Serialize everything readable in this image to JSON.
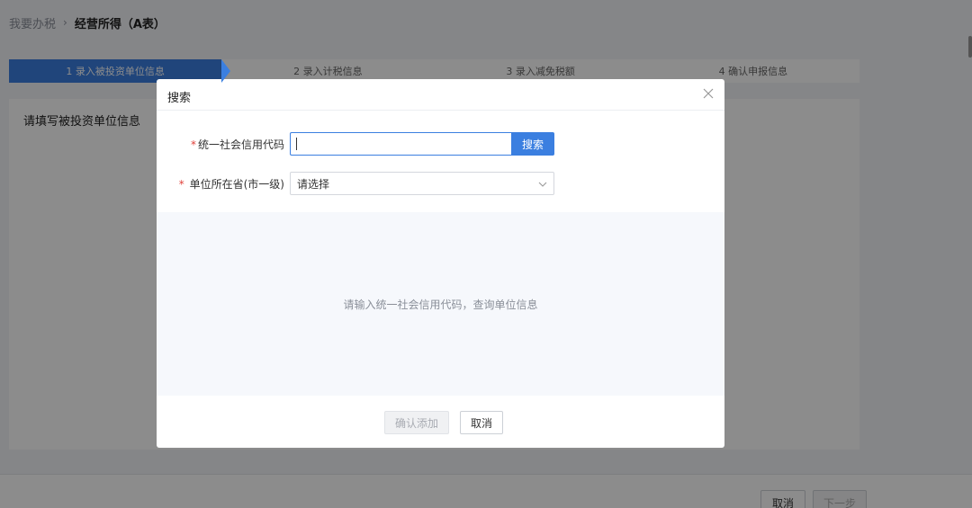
{
  "breadcrumb": {
    "parent": "我要办税",
    "separator": "›",
    "current": "经营所得（A表）"
  },
  "steps": [
    {
      "label": "1 录入被投资单位信息",
      "active": true
    },
    {
      "label": "2 录入计税信息",
      "active": false
    },
    {
      "label": "3 录入减免税额",
      "active": false
    },
    {
      "label": "4 确认申报信息",
      "active": false
    }
  ],
  "main": {
    "title": "请填写被投资单位信息"
  },
  "footer": {
    "cancel_label": "取消",
    "next_label": "下一步"
  },
  "dialog": {
    "title": "搜索",
    "fields": {
      "code": {
        "required_mark": "*",
        "label": "统一社会信用代码",
        "value": "",
        "search_label": "搜索"
      },
      "province": {
        "required_mark": "*",
        "label": "单位所在省(市一级)",
        "selected": "请选择"
      }
    },
    "hint": "请输入统一社会信用代码，查询单位信息",
    "confirm_label": "确认添加",
    "cancel_label": "取消"
  },
  "colors": {
    "primary": "#3b7fe0",
    "required": "#e0403a",
    "overlay": "rgba(0,0,0,0.45)"
  }
}
